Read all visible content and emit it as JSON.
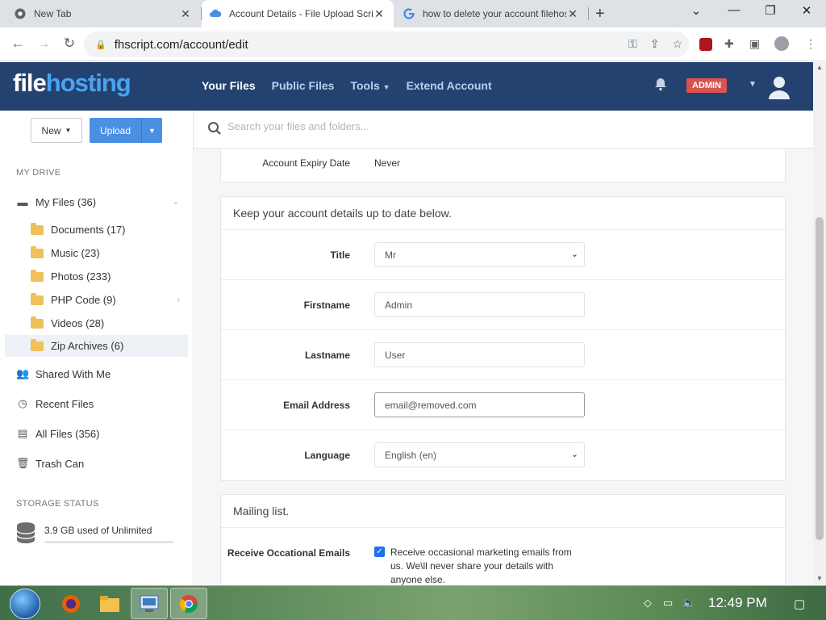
{
  "browser": {
    "tabs": [
      {
        "title": "New Tab",
        "icon": "chrome-icon"
      },
      {
        "title": "Account Details - File Upload Script",
        "icon": "filehosting-favicon"
      },
      {
        "title": "how to delete your account filehosting",
        "icon": "google-icon"
      }
    ],
    "url": "fhscript.com/account/edit"
  },
  "header": {
    "logo_part1": "file",
    "logo_part2": "hosting",
    "nav": [
      "Your Files",
      "Public Files",
      "Tools",
      "Extend Account"
    ],
    "badge": "ADMIN"
  },
  "sidebar": {
    "new_label": "New",
    "upload_label": "Upload",
    "section_drive": "MY DRIVE",
    "my_files": "My Files (36)",
    "folders": [
      "Documents (17)",
      "Music (23)",
      "Photos (233)",
      "PHP Code (9)",
      "Videos (28)",
      "Zip Archives (6)"
    ],
    "links": [
      "Shared With Me",
      "Recent Files",
      "All Files (356)",
      "Trash Can"
    ],
    "section_storage": "STORAGE STATUS",
    "storage_text": "3.9 GB used of Unlimited",
    "storage_fraction": 0.0
  },
  "search": {
    "placeholder": "Search your files and folders..."
  },
  "account": {
    "expiry_label": "Account Expiry Date",
    "expiry_value": "Never",
    "details_heading": "Keep your account details up to date below.",
    "title_label": "Title",
    "title_value": "Mr",
    "firstname_label": "Firstname",
    "firstname_value": "Admin",
    "lastname_label": "Lastname",
    "lastname_value": "User",
    "email_label": "Email Address",
    "email_value": "email@removed.com",
    "language_label": "Language",
    "language_value": "English (en)",
    "mailing_heading": "Mailing list.",
    "mailing_label": "Receive Occational Emails",
    "mailing_text": "Receive occasional marketing emails from us. We\\ll never share your details with anyone else.",
    "mailing_checked": true
  },
  "taskbar": {
    "clock": "12:49 PM"
  },
  "colors": {
    "header_bg": "#24426f",
    "accent": "#4a90e2",
    "badge": "#d9534f"
  }
}
